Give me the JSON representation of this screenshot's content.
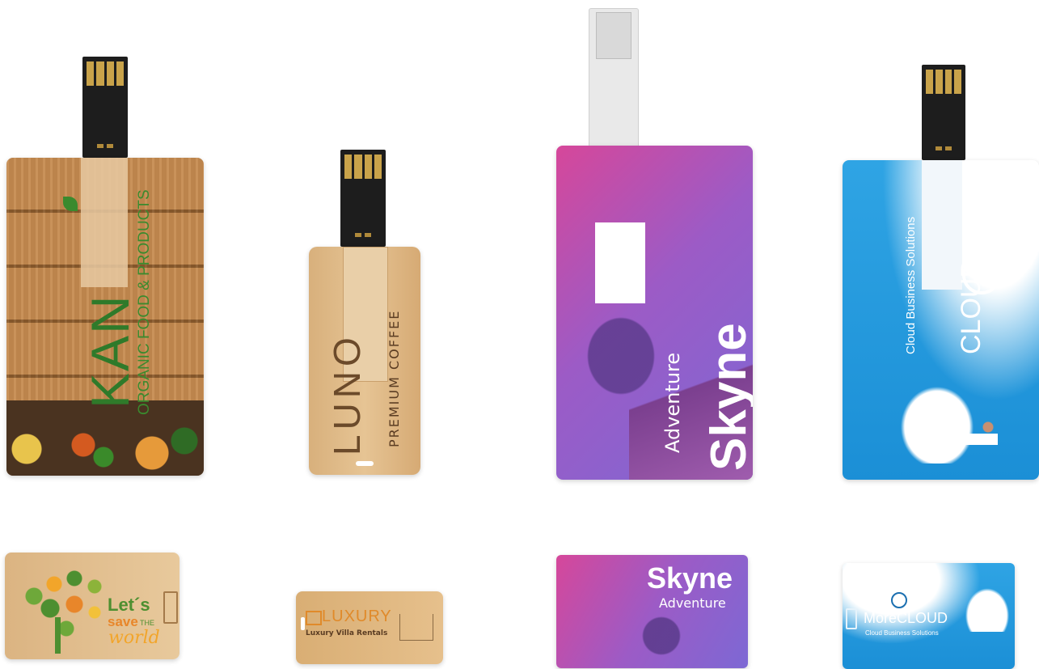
{
  "scene": {
    "description_colors": {
      "wood": "#c9955a",
      "bamboo": "#dcb888",
      "purple": "#9a5fc7",
      "blue": "#2a9fe0"
    }
  },
  "large_cards": [
    {
      "brand": "KAN",
      "tagline": "ORGANIC FOOD & PRODUCTS"
    },
    {
      "brand": "LUNO",
      "tagline": "PREMIUM COFFEE"
    },
    {
      "brand": "Skyne",
      "tagline": "Adventure"
    },
    {
      "brand": "CLOUD",
      "tagline": "Cloud Business Solutions"
    }
  ],
  "small_cards": [
    {
      "line1": "Let´s",
      "line2": "save",
      "line2b": "THE",
      "line3": "world"
    },
    {
      "brand": "LUXURY",
      "tagline": "Luxury Villa Rentals"
    },
    {
      "brand": "Skyne",
      "tagline": "Adventure"
    },
    {
      "brand": "MoreCLOUD",
      "tagline": "Cloud Business Solutions"
    }
  ]
}
